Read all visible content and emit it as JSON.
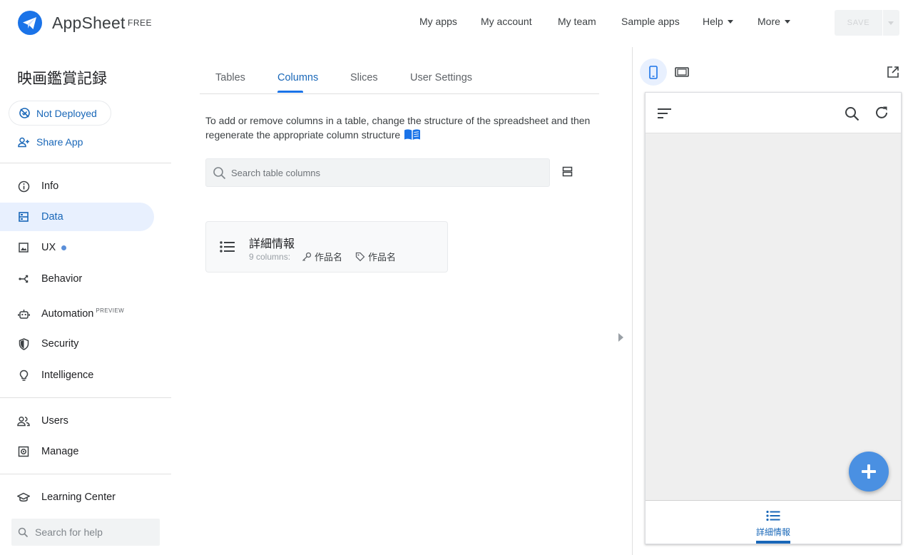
{
  "brand": {
    "name": "AppSheet",
    "plan": "FREE",
    "accent": "#1a73e8"
  },
  "topnav": {
    "items": [
      {
        "label": "My apps"
      },
      {
        "label": "My account"
      },
      {
        "label": "My team"
      },
      {
        "label": "Sample apps"
      },
      {
        "label": "Help"
      },
      {
        "label": "More"
      }
    ],
    "save_label": "SAVE"
  },
  "sidebar": {
    "app_name": "映画鑑賞記録",
    "deploy_status": "Not Deployed",
    "share_label": "Share App",
    "items": [
      {
        "label": "Info",
        "icon": "info-icon"
      },
      {
        "label": "Data",
        "icon": "data-icon",
        "active": true
      },
      {
        "label": "UX",
        "icon": "ux-icon"
      },
      {
        "label": "Behavior",
        "icon": "behavior-icon"
      },
      {
        "label": "Automation",
        "icon": "robot-icon",
        "badge": "PREVIEW"
      },
      {
        "label": "Security",
        "icon": "shield-icon"
      },
      {
        "label": "Intelligence",
        "icon": "lightbulb-icon"
      },
      {
        "label": "Users",
        "icon": "users-icon"
      },
      {
        "label": "Manage",
        "icon": "manage-icon"
      },
      {
        "label": "Learning Center",
        "icon": "graduation-cap-icon"
      }
    ],
    "help_search_placeholder": "Search for help"
  },
  "main": {
    "tabs": [
      {
        "label": "Tables"
      },
      {
        "label": "Columns",
        "active": true
      },
      {
        "label": "Slices"
      },
      {
        "label": "User Settings"
      }
    ],
    "hint": "To add or remove columns in a table, change the structure of the spreadsheet and then regenerate the appropriate column structure",
    "search_placeholder": "Search table columns",
    "tables": [
      {
        "name": "詳細情報",
        "columns": "9 columns:",
        "key": "作品名",
        "label": "作品名"
      }
    ]
  },
  "preview": {
    "footer_tab": "詳細情報",
    "fab_color": "#4a90e2"
  }
}
